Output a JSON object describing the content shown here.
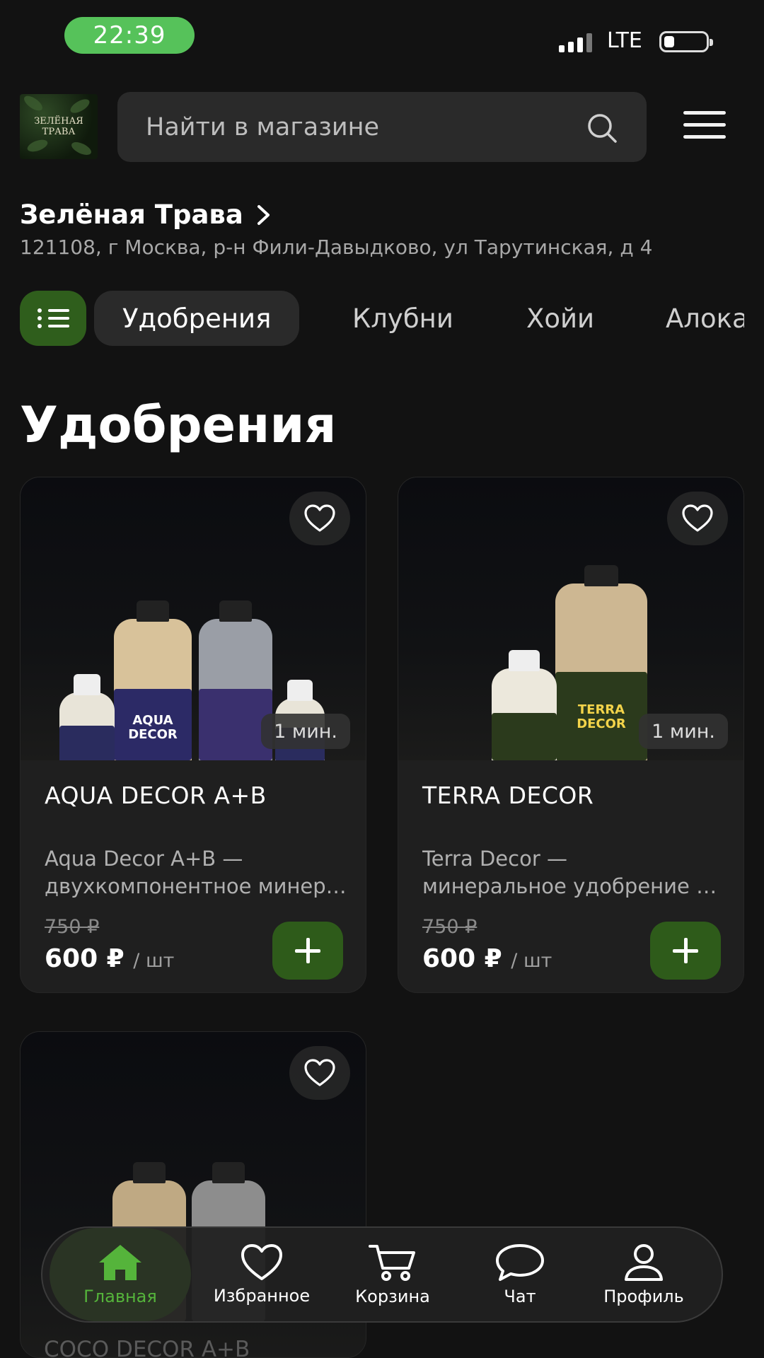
{
  "status_bar": {
    "time": "22:39",
    "network": "LTE"
  },
  "header": {
    "logo_line1": "ЗЕЛЁНАЯ",
    "logo_line2": "ТРАВА",
    "search_placeholder": "Найти в магазине"
  },
  "store": {
    "name": "Зелёная Трава",
    "address": "121108, г Москва, р-н Фили-Давыдково, ул Тарутинская, д 4"
  },
  "categories": [
    "Удобрения",
    "Клубни",
    "Хойи",
    "Алоказии"
  ],
  "section_title": "Удобрения",
  "products": [
    {
      "name": "AQUA DECOR A+B",
      "desc_line1": "Aqua Decor A+B —",
      "desc_line2": "двухкомпонентное минеральное удобрение",
      "old_price": "750 ₽",
      "price": "600 ₽",
      "unit": "/ шт",
      "time": "1 мин.",
      "bottle_text": "AQUA DECOR"
    },
    {
      "name": "TERRA DECOR",
      "desc_line1": "Terra Decor —",
      "desc_line2": "минеральное удобрение для растений",
      "old_price": "750 ₽",
      "price": "600 ₽",
      "unit": "/ шт",
      "time": "1 мин.",
      "bottle_text": "TERRA DECOR"
    },
    {
      "name": "COCO DECOR A+B"
    }
  ],
  "nav": [
    {
      "label": "Главная",
      "icon": "home-icon"
    },
    {
      "label": "Избранное",
      "icon": "heart-icon"
    },
    {
      "label": "Корзина",
      "icon": "cart-icon"
    },
    {
      "label": "Чат",
      "icon": "chat-icon"
    },
    {
      "label": "Профиль",
      "icon": "profile-icon"
    }
  ],
  "colors": {
    "accent": "#2e5b1a",
    "active_nav": "#55b43b",
    "status_time": "#56c25a"
  }
}
